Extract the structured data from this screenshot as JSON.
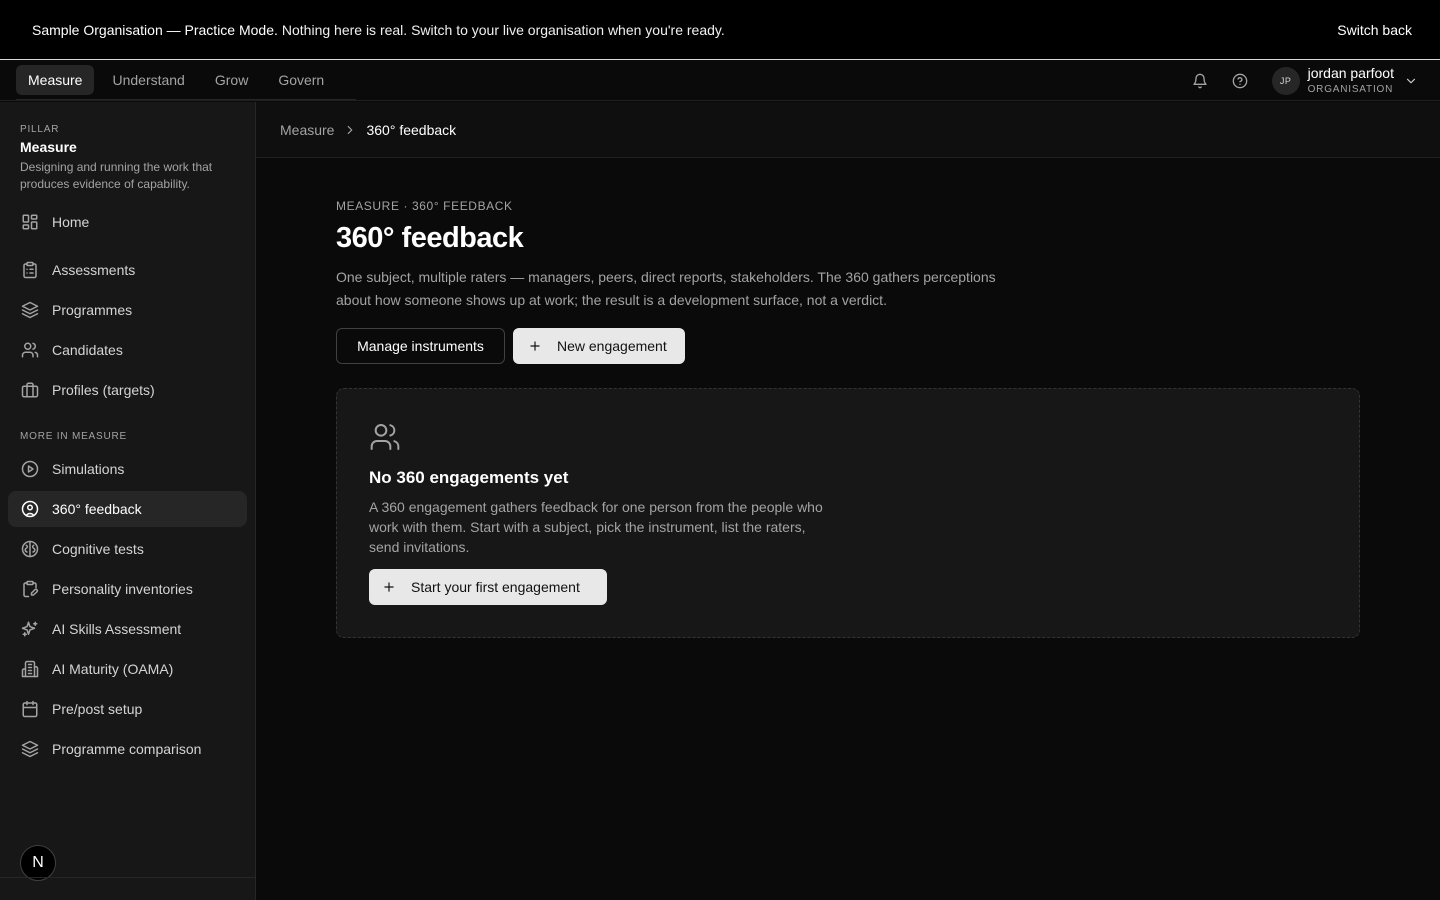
{
  "banner": {
    "strong": "Sample Organisation — Practice Mode.",
    "rest": "Nothing here is real. Switch to your live organisation when you're ready.",
    "switch_back": "Switch back"
  },
  "topnav": {
    "tabs": [
      {
        "label": "Measure",
        "active": true
      },
      {
        "label": "Understand"
      },
      {
        "label": "Grow"
      },
      {
        "label": "Govern"
      }
    ],
    "user": {
      "initials": "JP",
      "name": "jordan parfoot",
      "role": "ORGANISATION"
    }
  },
  "sidebar": {
    "pillar_label": "PILLAR",
    "pillar_title": "Measure",
    "pillar_desc": "Designing and running the work that produces evidence of capability.",
    "primary": [
      {
        "label": "Home",
        "icon": "grid-icon"
      },
      {
        "label": "Assessments",
        "icon": "clipboard-icon"
      },
      {
        "label": "Programmes",
        "icon": "layers-icon"
      },
      {
        "label": "Candidates",
        "icon": "users-icon"
      },
      {
        "label": "Profiles (targets)",
        "icon": "briefcase-icon"
      }
    ],
    "section_label": "MORE IN MEASURE",
    "more": [
      {
        "label": "Simulations",
        "icon": "play-circle-icon"
      },
      {
        "label": "360° feedback",
        "icon": "user-circle-icon",
        "active": true
      },
      {
        "label": "Cognitive tests",
        "icon": "brain-icon"
      },
      {
        "label": "Personality inventories",
        "icon": "clipboard-pen-icon"
      },
      {
        "label": "AI Skills Assessment",
        "icon": "sparkles-icon"
      },
      {
        "label": "AI Maturity (OAMA)",
        "icon": "building-icon"
      },
      {
        "label": "Pre/post setup",
        "icon": "calendar-icon"
      },
      {
        "label": "Programme comparison",
        "icon": "layers-icon"
      }
    ],
    "brand_letter": "N"
  },
  "breadcrumb": {
    "parent": "Measure",
    "current": "360° feedback"
  },
  "main": {
    "eyebrow": "MEASURE · 360° FEEDBACK",
    "title": "360° feedback",
    "lead": "One subject, multiple raters — managers, peers, direct reports, stakeholders. The 360 gathers perceptions about how someone shows up at work; the result is a development surface, not a verdict.",
    "manage_label": "Manage instruments",
    "new_label": "New engagement",
    "empty": {
      "title": "No 360 engagements yet",
      "desc": "A 360 engagement gathers feedback for one person from the people who work with them. Start with a subject, pick the instrument, list the raters, send invitations.",
      "cta": "Start your first engagement"
    }
  }
}
